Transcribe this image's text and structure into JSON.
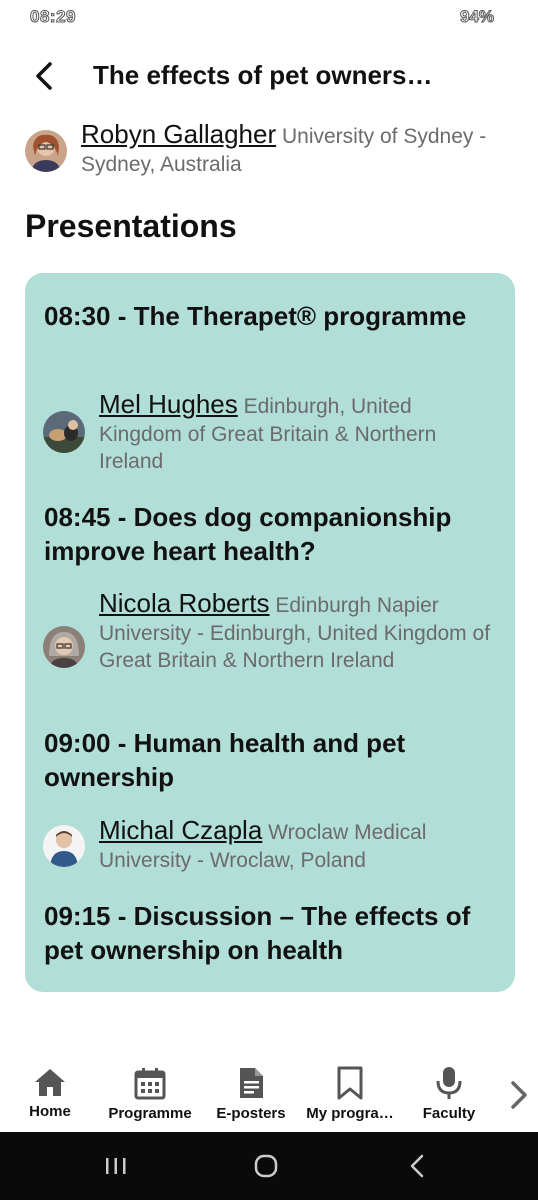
{
  "status": {
    "time": "08:29",
    "battery": "94%"
  },
  "header": {
    "title": "The effects of pet owners…"
  },
  "author": {
    "name": "Robyn Gallagher",
    "affiliation": "University of Sydney - Sydney, Australia"
  },
  "section_title": "Presentations",
  "presentations": [
    {
      "title": "08:30 - The Therapet® programme",
      "speaker": {
        "name": "Mel Hughes",
        "affiliation": "Edinburgh, United Kingdom of Great Britain & Northern Ireland"
      }
    },
    {
      "title": "08:45 - Does dog companionship improve heart health?",
      "speaker": {
        "name": "Nicola Roberts",
        "affiliation": "Edinburgh Napier University - Edinburgh, United Kingdom of Great Britain & Northern Ireland"
      }
    },
    {
      "title": "09:00 - Human health and pet ownership",
      "speaker": {
        "name": "Michal Czapla",
        "affiliation": "Wroclaw Medical University - Wroclaw, Poland"
      }
    },
    {
      "title": "09:15 - Discussion – The effects of pet ownership on health"
    }
  ],
  "nav": {
    "items": [
      {
        "label": "Home",
        "icon": "home-icon"
      },
      {
        "label": "Programme",
        "icon": "calendar-icon"
      },
      {
        "label": "E-posters",
        "icon": "document-icon"
      },
      {
        "label": "My progra…",
        "icon": "bookmark-icon"
      },
      {
        "label": "Faculty",
        "icon": "microphone-icon"
      }
    ],
    "more_icon": "chevron-right-icon"
  },
  "colors": {
    "card": "#b2ded8",
    "system_bar": "#0a0a0a"
  }
}
